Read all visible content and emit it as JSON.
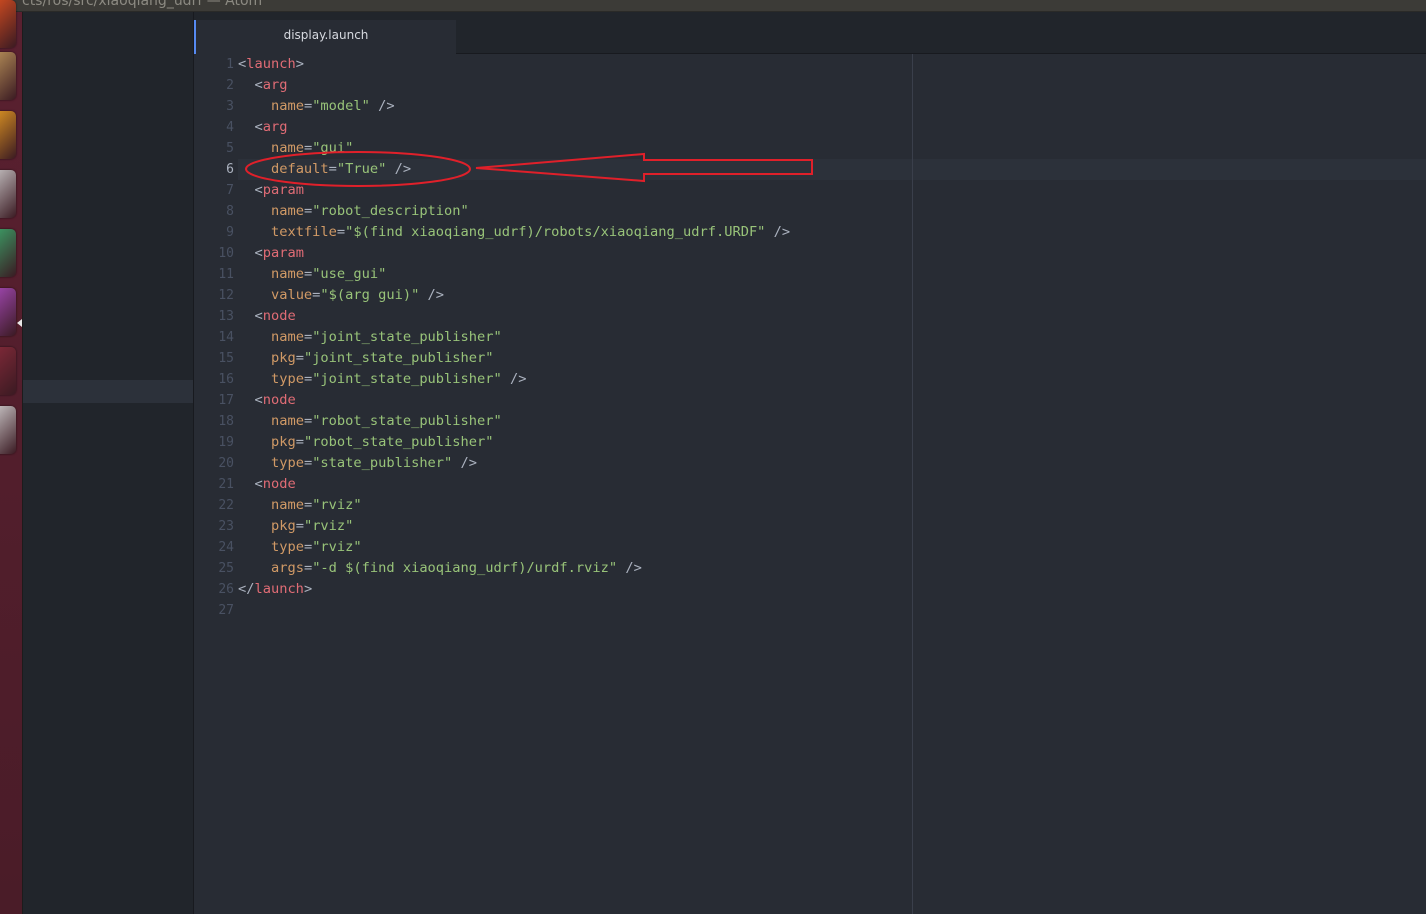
{
  "window": {
    "title": "cts/ros/src/xiaoqiang_udrf — Atom"
  },
  "tabs": [
    {
      "label": "display.launch",
      "active": true
    }
  ],
  "editor": {
    "cursor_line": 6,
    "lines": [
      [
        {
          "t": "<",
          "c": "punct"
        },
        {
          "t": "launch",
          "c": "tag"
        },
        {
          "t": ">",
          "c": "punct"
        }
      ],
      [
        {
          "t": "  <",
          "c": "punct"
        },
        {
          "t": "arg",
          "c": "tag"
        }
      ],
      [
        {
          "t": "    ",
          "c": "punct"
        },
        {
          "t": "name",
          "c": "attr"
        },
        {
          "t": "=",
          "c": "punct"
        },
        {
          "t": "\"model\"",
          "c": "str"
        },
        {
          "t": " />",
          "c": "punct"
        }
      ],
      [
        {
          "t": "  <",
          "c": "punct"
        },
        {
          "t": "arg",
          "c": "tag"
        }
      ],
      [
        {
          "t": "    ",
          "c": "punct"
        },
        {
          "t": "name",
          "c": "attr"
        },
        {
          "t": "=",
          "c": "punct"
        },
        {
          "t": "\"gui\"",
          "c": "str"
        }
      ],
      [
        {
          "t": "    ",
          "c": "punct"
        },
        {
          "t": "default",
          "c": "attr"
        },
        {
          "t": "=",
          "c": "punct"
        },
        {
          "t": "\"True\"",
          "c": "str"
        },
        {
          "t": " />",
          "c": "punct"
        }
      ],
      [
        {
          "t": "  <",
          "c": "punct"
        },
        {
          "t": "param",
          "c": "tag"
        }
      ],
      [
        {
          "t": "    ",
          "c": "punct"
        },
        {
          "t": "name",
          "c": "attr"
        },
        {
          "t": "=",
          "c": "punct"
        },
        {
          "t": "\"robot_description\"",
          "c": "str"
        }
      ],
      [
        {
          "t": "    ",
          "c": "punct"
        },
        {
          "t": "textfile",
          "c": "attr"
        },
        {
          "t": "=",
          "c": "punct"
        },
        {
          "t": "\"$(find xiaoqiang_udrf)/robots/xiaoqiang_udrf.URDF\"",
          "c": "str"
        },
        {
          "t": " />",
          "c": "punct"
        }
      ],
      [
        {
          "t": "  <",
          "c": "punct"
        },
        {
          "t": "param",
          "c": "tag"
        }
      ],
      [
        {
          "t": "    ",
          "c": "punct"
        },
        {
          "t": "name",
          "c": "attr"
        },
        {
          "t": "=",
          "c": "punct"
        },
        {
          "t": "\"use_gui\"",
          "c": "str"
        }
      ],
      [
        {
          "t": "    ",
          "c": "punct"
        },
        {
          "t": "value",
          "c": "attr"
        },
        {
          "t": "=",
          "c": "punct"
        },
        {
          "t": "\"$(arg gui)\"",
          "c": "str"
        },
        {
          "t": " />",
          "c": "punct"
        }
      ],
      [
        {
          "t": "  <",
          "c": "punct"
        },
        {
          "t": "node",
          "c": "tag"
        }
      ],
      [
        {
          "t": "    ",
          "c": "punct"
        },
        {
          "t": "name",
          "c": "attr"
        },
        {
          "t": "=",
          "c": "punct"
        },
        {
          "t": "\"joint_state_publisher\"",
          "c": "str"
        }
      ],
      [
        {
          "t": "    ",
          "c": "punct"
        },
        {
          "t": "pkg",
          "c": "attr"
        },
        {
          "t": "=",
          "c": "punct"
        },
        {
          "t": "\"joint_state_publisher\"",
          "c": "str"
        }
      ],
      [
        {
          "t": "    ",
          "c": "punct"
        },
        {
          "t": "type",
          "c": "attr"
        },
        {
          "t": "=",
          "c": "punct"
        },
        {
          "t": "\"joint_state_publisher\"",
          "c": "str"
        },
        {
          "t": " />",
          "c": "punct"
        }
      ],
      [
        {
          "t": "  <",
          "c": "punct"
        },
        {
          "t": "node",
          "c": "tag"
        }
      ],
      [
        {
          "t": "    ",
          "c": "punct"
        },
        {
          "t": "name",
          "c": "attr"
        },
        {
          "t": "=",
          "c": "punct"
        },
        {
          "t": "\"robot_state_publisher\"",
          "c": "str"
        }
      ],
      [
        {
          "t": "    ",
          "c": "punct"
        },
        {
          "t": "pkg",
          "c": "attr"
        },
        {
          "t": "=",
          "c": "punct"
        },
        {
          "t": "\"robot_state_publisher\"",
          "c": "str"
        }
      ],
      [
        {
          "t": "    ",
          "c": "punct"
        },
        {
          "t": "type",
          "c": "attr"
        },
        {
          "t": "=",
          "c": "punct"
        },
        {
          "t": "\"state_publisher\"",
          "c": "str"
        },
        {
          "t": " />",
          "c": "punct"
        }
      ],
      [
        {
          "t": "  <",
          "c": "punct"
        },
        {
          "t": "node",
          "c": "tag"
        }
      ],
      [
        {
          "t": "    ",
          "c": "punct"
        },
        {
          "t": "name",
          "c": "attr"
        },
        {
          "t": "=",
          "c": "punct"
        },
        {
          "t": "\"rviz\"",
          "c": "str"
        }
      ],
      [
        {
          "t": "    ",
          "c": "punct"
        },
        {
          "t": "pkg",
          "c": "attr"
        },
        {
          "t": "=",
          "c": "punct"
        },
        {
          "t": "\"rviz\"",
          "c": "str"
        }
      ],
      [
        {
          "t": "    ",
          "c": "punct"
        },
        {
          "t": "type",
          "c": "attr"
        },
        {
          "t": "=",
          "c": "punct"
        },
        {
          "t": "\"rviz\"",
          "c": "str"
        }
      ],
      [
        {
          "t": "    ",
          "c": "punct"
        },
        {
          "t": "args",
          "c": "attr"
        },
        {
          "t": "=",
          "c": "punct"
        },
        {
          "t": "\"-d $(find xiaoqiang_udrf)/urdf.rviz\"",
          "c": "str"
        },
        {
          "t": " />",
          "c": "punct"
        }
      ],
      [
        {
          "t": "</",
          "c": "punct"
        },
        {
          "t": "launch",
          "c": "tag"
        },
        {
          "t": ">",
          "c": "punct"
        }
      ],
      [
        {
          "t": "",
          "c": "punct"
        }
      ]
    ]
  },
  "launcher": {
    "icons": [
      {
        "name": "ubuntu-dash-icon",
        "color": "#e95420"
      },
      {
        "name": "files-icon",
        "color": "#c8a060"
      },
      {
        "name": "firefox-icon",
        "color": "#f5a623"
      },
      {
        "name": "terminal-icon",
        "color": "#d8d8d8"
      },
      {
        "name": "chat-icon",
        "color": "#3cb371"
      },
      {
        "name": "calculator-icon",
        "color": "#b04fc8"
      },
      {
        "name": "app-icon",
        "color": "#8c2c3c"
      },
      {
        "name": "text-editor-icon",
        "color": "#e0e0e0"
      }
    ]
  },
  "colors": {
    "annotation": "#e0202a",
    "accent": "#568af2"
  }
}
